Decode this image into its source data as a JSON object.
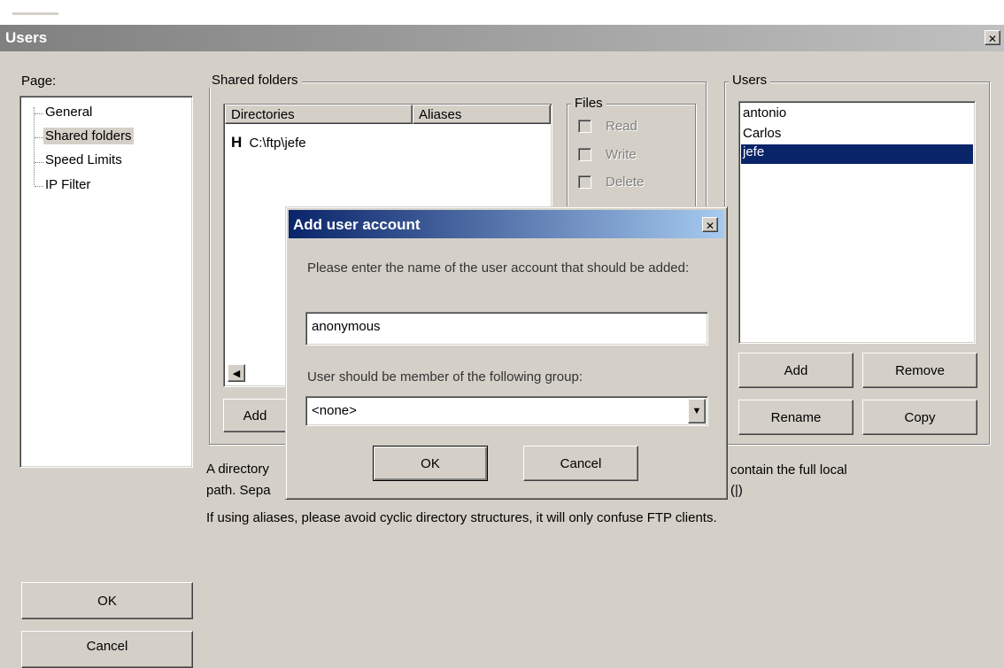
{
  "window": {
    "title": "Users",
    "close_glyph": "✕"
  },
  "page_tree": {
    "label": "Page:",
    "items": [
      {
        "label": "General",
        "selected": false
      },
      {
        "label": "Shared folders",
        "selected": true
      },
      {
        "label": "Speed Limits",
        "selected": false
      },
      {
        "label": "IP Filter",
        "selected": false
      }
    ]
  },
  "shared_folders": {
    "legend": "Shared folders",
    "columns": [
      "Directories",
      "Aliases"
    ],
    "rows": [
      {
        "marker": "H",
        "path": "C:\\ftp\\jefe"
      }
    ],
    "add_button": "Add",
    "files_group": {
      "legend": "Files",
      "checkboxes": [
        "Read",
        "Write",
        "Delete"
      ]
    }
  },
  "users_panel": {
    "legend": "Users",
    "users": [
      "antonio",
      "Carlos",
      "jefe"
    ],
    "selected_user": "jefe",
    "buttons": {
      "add": "Add",
      "remove": "Remove",
      "rename": "Rename",
      "copy": "Copy"
    }
  },
  "info_text": {
    "line1_left": "A directory",
    "line1_right": "contain the full local",
    "line2_left": "path. Sepa",
    "line2_right": "(|)",
    "line3": "If using aliases, please avoid cyclic directory structures, it will only confuse FTP clients."
  },
  "main_buttons": {
    "ok": "OK",
    "cancel": "Cancel"
  },
  "dialog": {
    "title": "Add user account",
    "close_glyph": "✕",
    "prompt": "Please enter the name of the user account that should be added:",
    "username_value": "anonymous",
    "group_label": "User should be member of the following group:",
    "group_selected": "<none>",
    "ok": "OK",
    "cancel": "Cancel"
  },
  "colors": {
    "face": "#d4d0c8",
    "selection": "#0a246a",
    "dialog_title_start": "#0a246a",
    "dialog_title_end": "#a6caf0"
  }
}
